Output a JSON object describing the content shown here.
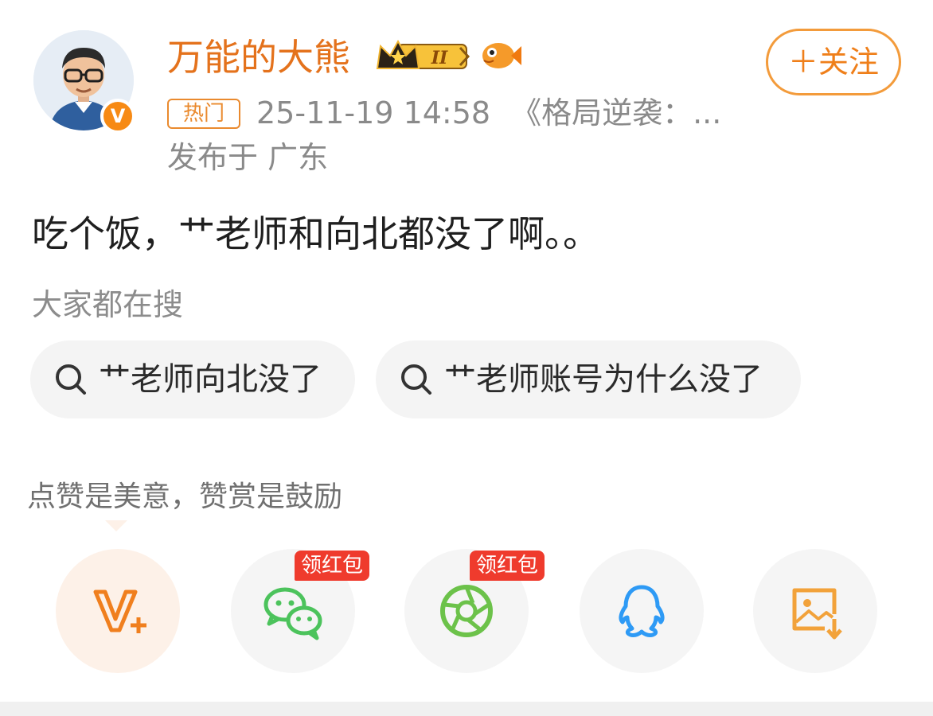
{
  "header": {
    "username": "万能的大熊",
    "badge_level": "II",
    "follow_label": "＋关注",
    "hot_tag": "热门",
    "timestamp": "25-11-19 14:58",
    "source": "《格局逆袭：...",
    "location": "发布于 广东",
    "avatar_badge": "V"
  },
  "post": {
    "text": "吃个饭，艹老师和向北都没了啊。。"
  },
  "search": {
    "heading": "大家都在搜",
    "chips": [
      {
        "label": "艹老师向北没了",
        "icon": "search-icon"
      },
      {
        "label": "艹老师账号为什么没了",
        "icon": "search-icon"
      }
    ]
  },
  "reward": {
    "hint": "点赞是美意，赞赏是鼓励"
  },
  "share": {
    "items": [
      {
        "name": "reward",
        "icon": "v-plus-icon"
      },
      {
        "name": "wechat",
        "icon": "wechat-icon",
        "badge": "领红包"
      },
      {
        "name": "moments",
        "icon": "moments-icon",
        "badge": "领红包"
      },
      {
        "name": "qq",
        "icon": "qq-icon"
      },
      {
        "name": "save-image",
        "icon": "save-image-icon"
      }
    ]
  },
  "colors": {
    "accent_orange": "#e4721c",
    "follow_border": "#f39b3b",
    "redpack": "#ef3b2d",
    "wechat_green": "#4cc35c",
    "qq_blue": "#2e9af5"
  }
}
